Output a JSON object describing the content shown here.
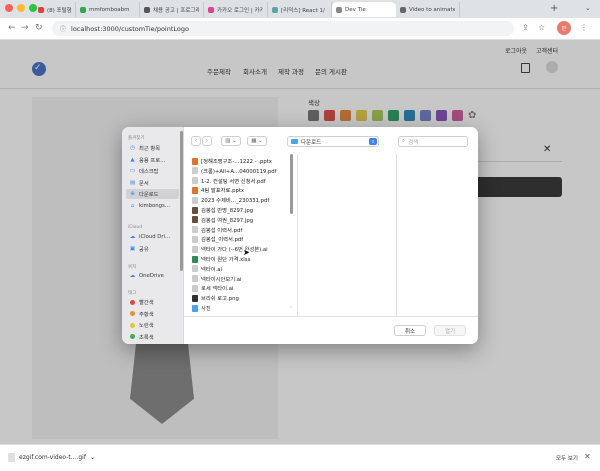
{
  "browser": {
    "tabs": [
      {
        "label": "(8) 포털형 메 ×",
        "color": "#e04040"
      },
      {
        "label": "mmfomboabm",
        "color": "#2fa84f"
      },
      {
        "label": "채용 공고 | 프로그래",
        "color": "#555555"
      },
      {
        "label": "카카오 로그인 | 카카오",
        "color": "#e3418f"
      },
      {
        "label": "[리덕스] React 1/",
        "color": "#58a6a6"
      },
      {
        "label": "Dev Tie",
        "color": "#888888"
      },
      {
        "label": "Video to animated",
        "color": "#666666"
      }
    ],
    "active_tab": 5,
    "url": "localhost:3000/customTie/pointLogo",
    "profile_badge": "반"
  },
  "page": {
    "util_links": [
      "로그아웃",
      "고객센터"
    ],
    "nav": [
      "주문제작",
      "회사소개",
      "제작 과정",
      "문의 게시판"
    ],
    "color_label": "색상",
    "swatches": [
      "#7a7a7a",
      "#e2544a",
      "#e88a3a",
      "#e6cf4a",
      "#a8cf58",
      "#2fa86a",
      "#2e8fc5",
      "#7a86cc",
      "#8a56c3",
      "#d55fa6"
    ]
  },
  "dialog": {
    "sidebar": {
      "favorites_heading": "즐겨찾기",
      "favorites": [
        {
          "icon": "clock-icon",
          "glyph": "◷",
          "label": "최근 항목"
        },
        {
          "icon": "apps-icon",
          "glyph": "▲",
          "label": "응용 프로…"
        },
        {
          "icon": "desktop-icon",
          "glyph": "▭",
          "label": "데스크탑"
        },
        {
          "icon": "document-icon",
          "glyph": "▤",
          "label": "문서"
        },
        {
          "icon": "download-icon",
          "glyph": "⊕",
          "label": "다운로드"
        },
        {
          "icon": "home-icon",
          "glyph": "⌂",
          "label": "kimbongs…"
        }
      ],
      "selected_index": 4,
      "icloud_heading": "iCloud",
      "icloud": [
        {
          "icon": "cloud-icon",
          "glyph": "☁",
          "label": "iCloud Dri…"
        },
        {
          "icon": "shared-icon",
          "glyph": "▣",
          "label": "공유"
        }
      ],
      "locations_heading": "위치",
      "locations": [
        {
          "icon": "cloud-icon",
          "glyph": "☁",
          "label": "OneDrive"
        }
      ],
      "tags_heading": "태그",
      "tags": [
        {
          "label": "빨간색",
          "color": "#e0443a"
        },
        {
          "label": "주황색",
          "color": "#f08a2a"
        },
        {
          "label": "노란색",
          "color": "#e9c826"
        },
        {
          "label": "초록색",
          "color": "#37b24d"
        }
      ]
    },
    "toolbar": {
      "back": "‹",
      "forward": "›",
      "view_columns": "▥ ⌄",
      "view_grid": "▦ ⌄",
      "location": "다운로드",
      "search_placeholder": "검색"
    },
    "files": [
      {
        "name": "[정해조명구조-…1222 - .pptx",
        "color": "#e0722a"
      },
      {
        "name": "(크롬)+All+A…04000119.pdf",
        "color": "#cccccc"
      },
      {
        "name": "1-2. 컨설팅 서면 신청서.pdf",
        "color": "#cccccc"
      },
      {
        "name": "4팀 발표자료.pptx",
        "color": "#e0722a"
      },
      {
        "name": "2023 수제비…_230331.pdf",
        "color": "#cccccc"
      },
      {
        "name": "김봉섭 반명_8297.jpg",
        "color": "#6b4b3a"
      },
      {
        "name": "김봉섭 여권_8297.jpg",
        "color": "#6b4b3a"
      },
      {
        "name": "김봉섭 이력서.pdf",
        "color": "#cccccc"
      },
      {
        "name": "김봉섭_이력서.pdf",
        "color": "#cccccc"
      },
      {
        "name": "넥타이 가다 (--6번 완성본).ai",
        "color": "#cccccc"
      },
      {
        "name": "넥타이 원단 가격.xlsx",
        "color": "#2e8b57"
      },
      {
        "name": "넥타이.ai",
        "color": "#cccccc"
      },
      {
        "name": "넥타이시안보기.ai",
        "color": "#cccccc"
      },
      {
        "name": "로세 넥타이.ai",
        "color": "#cccccc"
      },
      {
        "name": "브리쉬 로고.png",
        "color": "#333333"
      },
      {
        "name": "사진",
        "color": "#4aa3f0"
      }
    ],
    "buttons": {
      "cancel": "취소",
      "open": "열기"
    }
  },
  "downloads": {
    "file": "ezgif.com-video-t....gif",
    "show_all": "모두 보기"
  }
}
